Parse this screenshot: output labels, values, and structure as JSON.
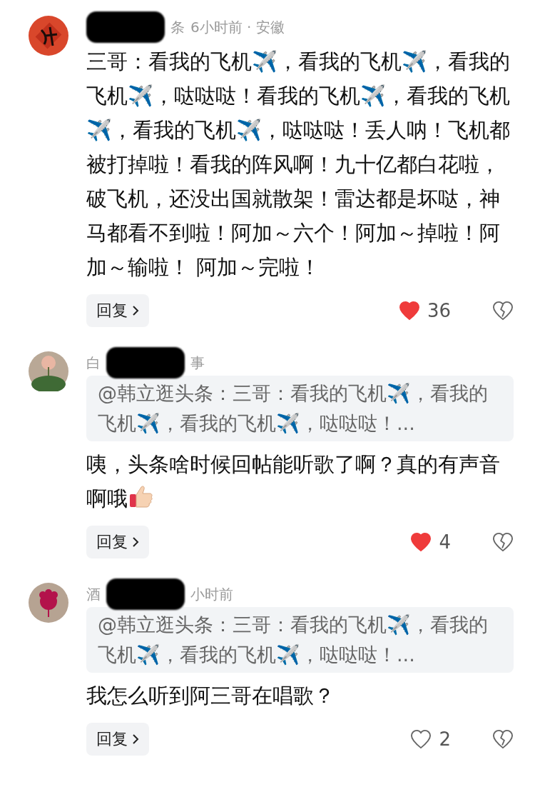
{
  "comments": [
    {
      "meta": [
        {
          "kind": "redacted"
        },
        {
          "kind": "text",
          "text": "条"
        },
        {
          "kind": "text",
          "text": "6小时前 · 安徽"
        }
      ],
      "text": "三哥：看我的飞机✈️，看我的飞机✈️，看我的飞机✈️，哒哒哒！看我的飞机✈️，看我的飞机✈️，看我的飞机✈️，哒哒哒！丢人呐！飞机都被打掉啦！看我的阵风啊！九十亿都白花啦，破飞机，还没出国就散架！雷达都是坏哒，神马都看不到啦！阿加～六个！阿加～掉啦！阿加～输啦！ 阿加～完啦！",
      "thumbs": false,
      "reply": "回复",
      "likes": "36",
      "liked": true
    },
    {
      "meta": [
        {
          "kind": "text",
          "text": "白"
        },
        {
          "kind": "redacted"
        },
        {
          "kind": "text",
          "text": "事"
        }
      ],
      "quote": "@韩立逛头条：三哥：看我的飞机✈️，看我的飞机✈️，看我的飞机✈️，哒哒哒！...",
      "text": "咦，头条啥时候回帖能听歌了啊？真的有声音啊哦",
      "thumbs": true,
      "reply": "回复",
      "likes": "4",
      "liked": true
    },
    {
      "meta": [
        {
          "kind": "text",
          "text": "酒"
        },
        {
          "kind": "redacted"
        },
        {
          "kind": "text",
          "text": "小时前"
        }
      ],
      "quote": "@韩立逛头条：三哥：看我的飞机✈️，看我的飞机✈️，看我的飞机✈️，哒哒哒！...",
      "text": "我怎么听到阿三哥在唱歌？",
      "thumbs": false,
      "reply": "回复",
      "likes": "2",
      "liked": false
    }
  ]
}
